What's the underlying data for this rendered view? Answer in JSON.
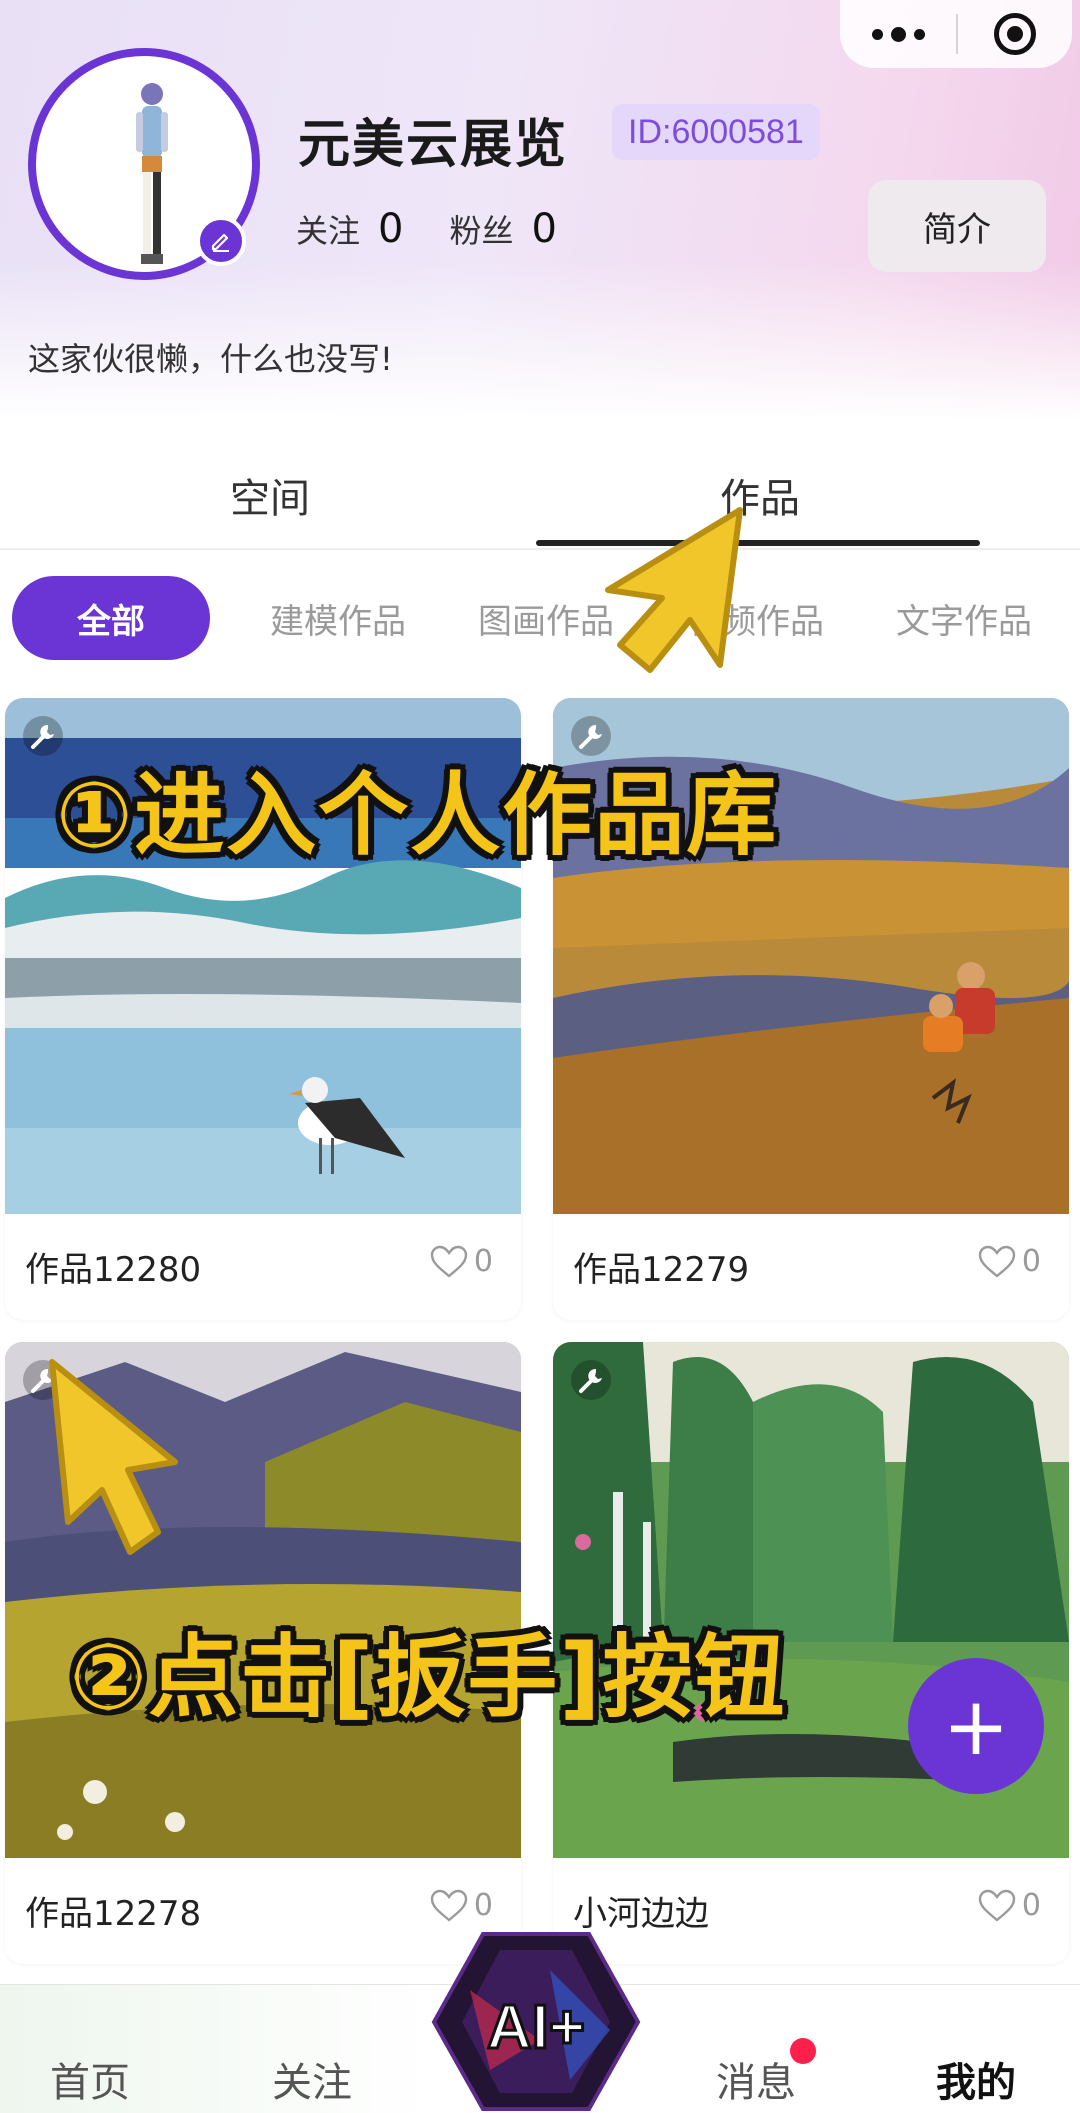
{
  "profile": {
    "username": "元美云展览",
    "id_badge": "ID:6000581",
    "following_label": "关注",
    "following_count": "0",
    "fans_label": "粉丝",
    "fans_count": "0",
    "intro_button": "简介",
    "bio": "这家伙很懒，什么也没写!"
  },
  "tabs": [
    {
      "label": "空间"
    },
    {
      "label": "作品",
      "active": true
    }
  ],
  "categories": [
    {
      "label": "全部",
      "active": true
    },
    {
      "label": "建模作品"
    },
    {
      "label": "图画作品"
    },
    {
      "label": "视频作品"
    },
    {
      "label": "文字作品"
    }
  ],
  "works": [
    {
      "title": "作品12280",
      "likes": "0"
    },
    {
      "title": "作品12279",
      "likes": "0"
    },
    {
      "title": "作品12278",
      "likes": "0"
    },
    {
      "title": "小河边边",
      "likes": "0"
    }
  ],
  "overlays": {
    "step1": "①进入个人作品库",
    "step2": "②点击[扳手]按钮"
  },
  "fab_label": "+",
  "bottom_nav": [
    {
      "label": "首页"
    },
    {
      "label": "关注"
    },
    {
      "label": "AI+"
    },
    {
      "label": "消息",
      "badge": true
    },
    {
      "label": "我的",
      "active": true
    }
  ],
  "colors": {
    "accent": "#6b35d6",
    "badge_bg": "#e4d7fa",
    "overlay_text": "#f5c419",
    "notification": "#ff1f4b"
  },
  "icons": [
    "more-icon",
    "target-icon",
    "edit-icon",
    "wrench-icon",
    "heart-icon",
    "cursor-arrow-icon",
    "plus-icon"
  ]
}
